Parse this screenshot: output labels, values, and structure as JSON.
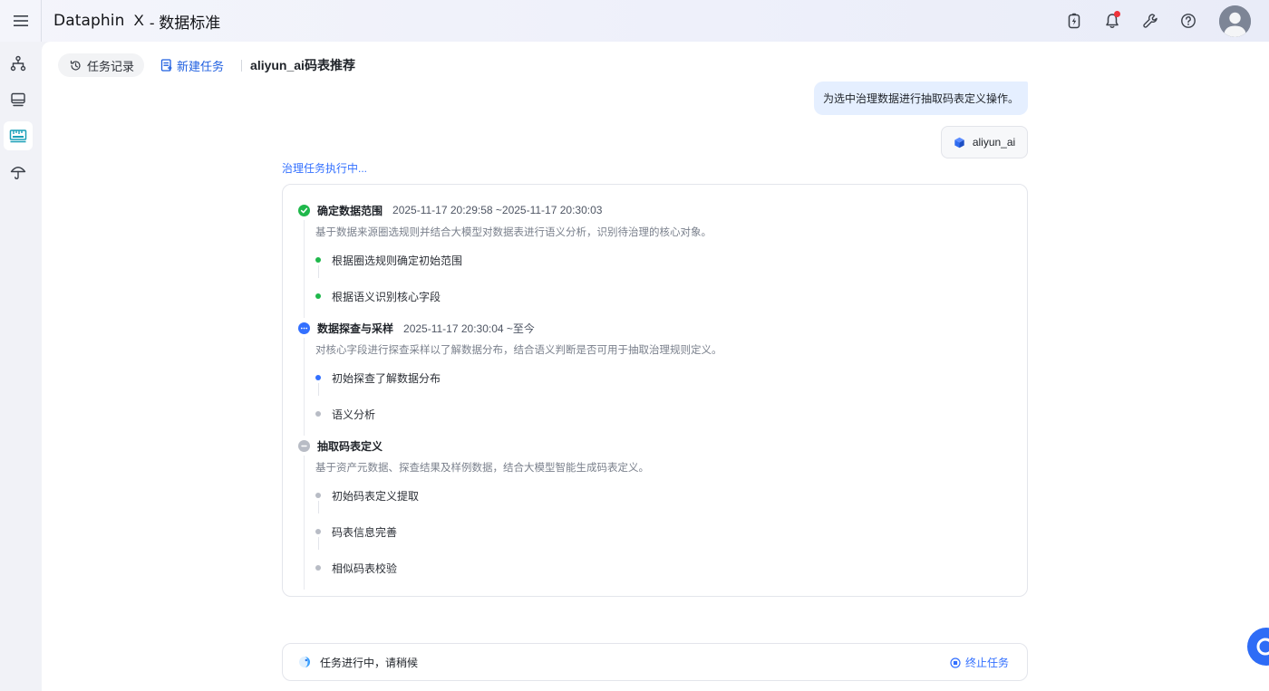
{
  "header": {
    "brand": "Dataphin",
    "separator": "X",
    "app_title": "- 数据标准"
  },
  "tabs": {
    "history_label": "任务记录",
    "new_task_label": "新建任务",
    "title": "aliyun_ai码表推荐"
  },
  "chat": {
    "user_message": "为选中治理数据进行抽取码表定义操作。",
    "agent_name": "aliyun_ai",
    "status": "治理任务执行中..."
  },
  "steps": [
    {
      "title": "确定数据范围",
      "time": "2025-11-17 20:29:58 ~2025-11-17 20:30:03",
      "state": "done",
      "description": "基于数据来源圈选规则并结合大模型对数据表进行语义分析，识别待治理的核心对象。",
      "subs": [
        {
          "label": "根据圈选规则确定初始范围",
          "state": "done"
        },
        {
          "label": "根据语义识别核心字段",
          "state": "done"
        }
      ]
    },
    {
      "title": "数据探查与采样",
      "time": "2025-11-17 20:30:04 ~至今",
      "state": "running",
      "description": "对核心字段进行探查采样以了解数据分布，结合语义判断是否可用于抽取治理规则定义。",
      "subs": [
        {
          "label": "初始探查了解数据分布",
          "state": "running"
        },
        {
          "label": "语义分析",
          "state": "pending"
        }
      ]
    },
    {
      "title": "抽取码表定义",
      "time": "",
      "state": "pending",
      "description": "基于资产元数据、探查结果及样例数据，结合大模型智能生成码表定义。",
      "subs": [
        {
          "label": "初始码表定义提取",
          "state": "pending"
        },
        {
          "label": "码表信息完善",
          "state": "pending"
        },
        {
          "label": "相似码表校验",
          "state": "pending"
        }
      ]
    }
  ],
  "bottom": {
    "progress_text": "任务进行中，请稍候",
    "stop_label": "终止任务"
  },
  "colors": {
    "done": "#1fb84b",
    "running": "#3370ff",
    "pending": "#b8bcc5",
    "accent": "#3370ff"
  },
  "icons": {
    "menu": "menu-icon",
    "flash": "flash-battery-icon",
    "bell": "bell-icon",
    "wrench": "wrench-icon",
    "help": "help-icon",
    "lineage": "lineage-icon",
    "monitor": "monitor-icon",
    "standard": "standard-ruler-icon",
    "umbrella": "umbrella-icon"
  }
}
